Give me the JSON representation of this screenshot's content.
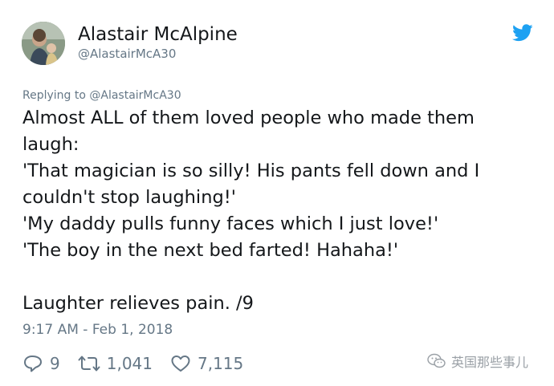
{
  "author": {
    "name": "Alastair McAlpine",
    "handle": "@AlastairMcA30"
  },
  "reply": {
    "text": "Replying to @AlastairMcA30"
  },
  "tweet": {
    "lines": [
      "Almost ALL of them loved people who made them",
      "laugh:",
      "'That magician is so silly! His pants fell down and I",
      "couldn't stop laughing!'",
      "'My daddy pulls funny faces which I just love!'",
      "'The boy in the next bed farted! Hahaha!'",
      "",
      "Laughter relieves pain. /9"
    ]
  },
  "meta": {
    "timestamp": "9:17 AM - Feb 1, 2018"
  },
  "actions": {
    "replies": "9",
    "retweets": "1,041",
    "likes": "7,115"
  },
  "watermark": {
    "text": "英国那些事儿"
  },
  "icons": {
    "logo": "twitter-bird-icon",
    "reply": "reply-bubble-icon",
    "retweet": "retweet-icon",
    "like": "heart-icon",
    "watermark": "wechat-icon"
  },
  "colors": {
    "brand": "#1da1f2",
    "text": "#14171a",
    "muted": "#657786"
  }
}
